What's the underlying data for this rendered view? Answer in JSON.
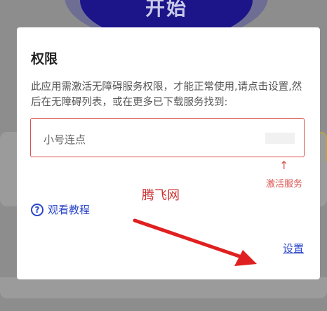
{
  "background": {
    "start_button_label": "开始"
  },
  "dialog": {
    "title": "权限",
    "message": "此应用需激活无障碍服务权限，才能正常使用,请点击设置,然后在无障碍列表，或在更多已下载服务找到:",
    "name_field_value": "小号连点",
    "arrow_glyph": "↑",
    "hint_label": "激活服务",
    "watermark": "腾飞网",
    "tutorial_label": "观看教程",
    "help_glyph": "?",
    "settings_label": "设置"
  },
  "colors": {
    "accent_blue": "#2c46c9",
    "annotation_red": "#d9534f",
    "start_button": "#1b1589"
  },
  "icons": [
    "help-circle-icon",
    "red-arrow-icon"
  ]
}
